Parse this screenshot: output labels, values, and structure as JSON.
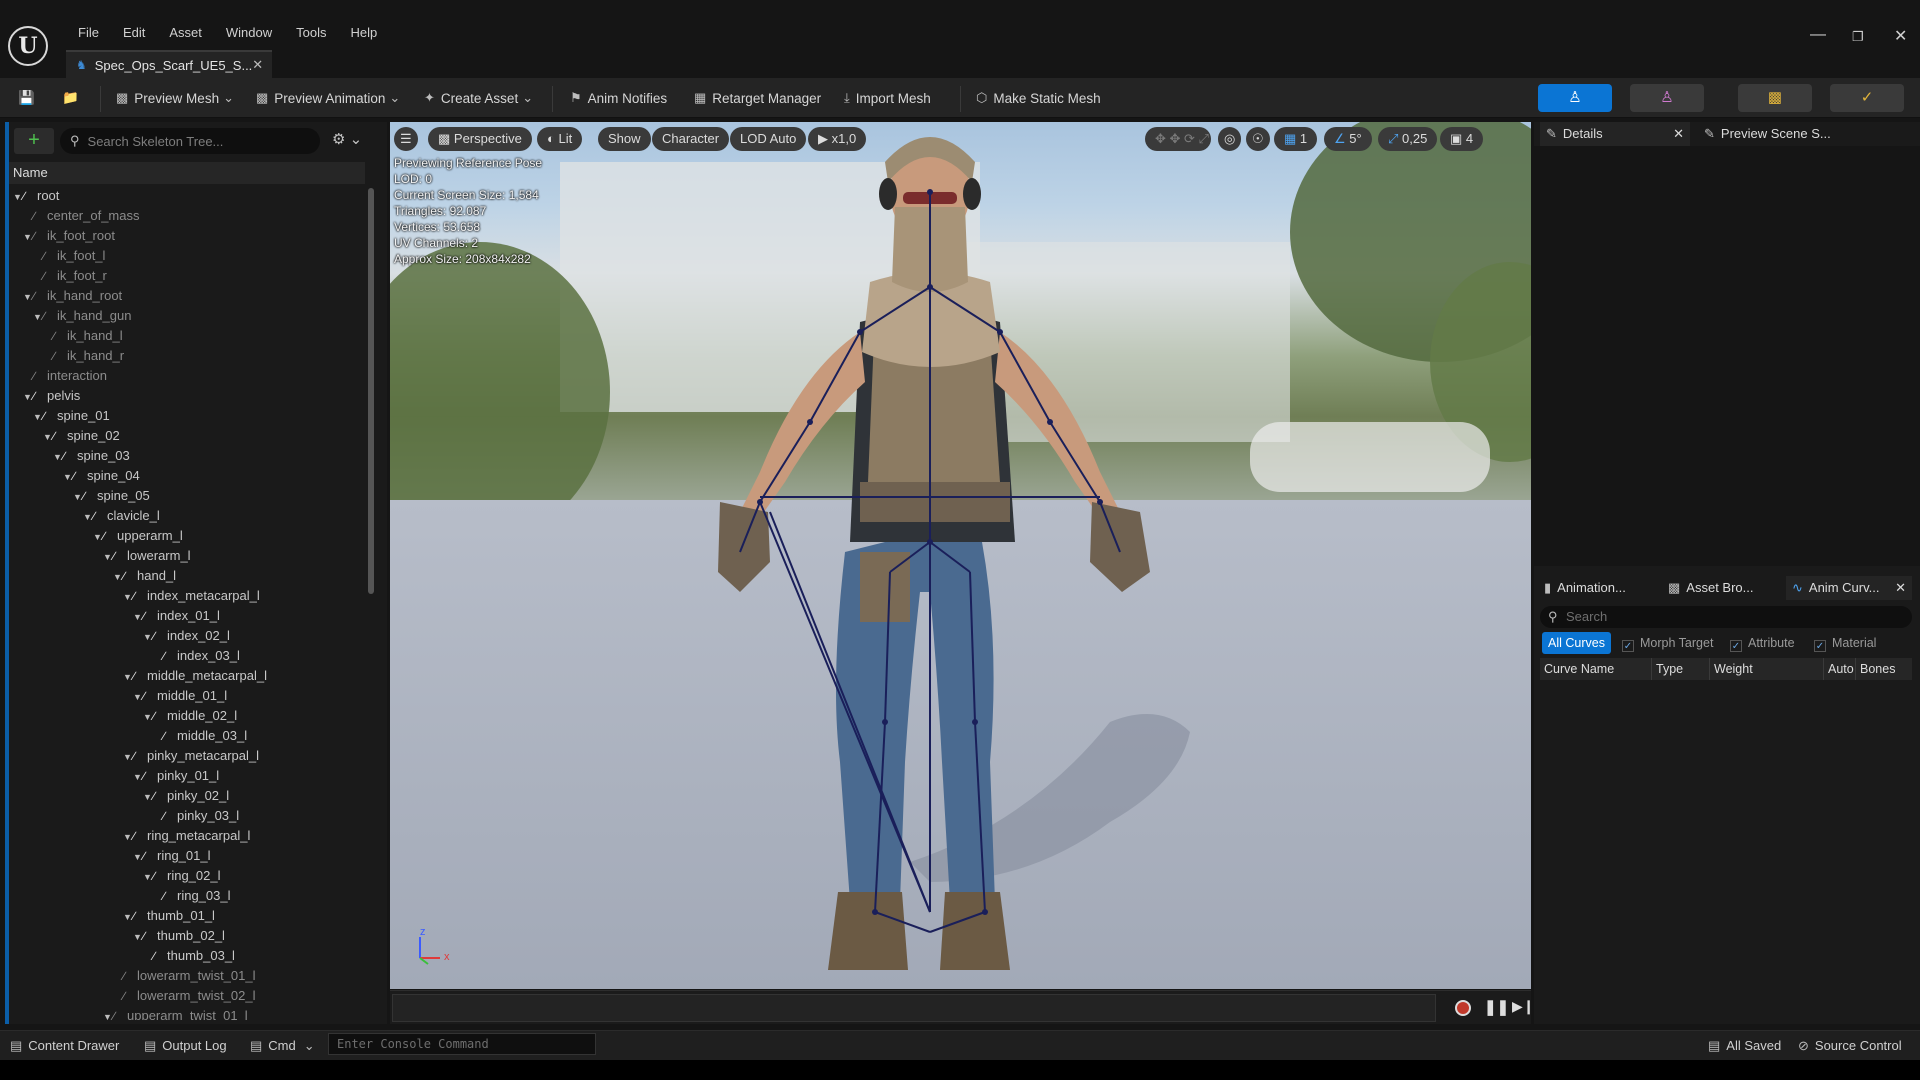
{
  "window": {
    "menu": [
      "File",
      "Edit",
      "Asset",
      "Window",
      "Tools",
      "Help"
    ],
    "tab_title": "Spec_Ops_Scarf_UE5_S...",
    "logo": "U"
  },
  "toolbar": {
    "preview_mesh": "Preview Mesh",
    "preview_animation": "Preview Animation",
    "create_asset": "Create Asset",
    "anim_notifies": "Anim Notifies",
    "retarget_manager": "Retarget Manager",
    "import_mesh": "Import Mesh",
    "make_static_mesh": "Make Static Mesh"
  },
  "skeleton_tree": {
    "search_placeholder": "Search Skeleton Tree...",
    "column_name": "Name",
    "bones": [
      {
        "name": "root",
        "depth": 0,
        "dim": false,
        "expanded": true
      },
      {
        "name": "center_of_mass",
        "depth": 1,
        "dim": true,
        "expanded": null
      },
      {
        "name": "ik_foot_root",
        "depth": 1,
        "dim": true,
        "expanded": true
      },
      {
        "name": "ik_foot_l",
        "depth": 2,
        "dim": true,
        "expanded": null
      },
      {
        "name": "ik_foot_r",
        "depth": 2,
        "dim": true,
        "expanded": null
      },
      {
        "name": "ik_hand_root",
        "depth": 1,
        "dim": true,
        "expanded": true
      },
      {
        "name": "ik_hand_gun",
        "depth": 2,
        "dim": true,
        "expanded": true
      },
      {
        "name": "ik_hand_l",
        "depth": 3,
        "dim": true,
        "expanded": null
      },
      {
        "name": "ik_hand_r",
        "depth": 3,
        "dim": true,
        "expanded": null
      },
      {
        "name": "interaction",
        "depth": 1,
        "dim": true,
        "expanded": null
      },
      {
        "name": "pelvis",
        "depth": 1,
        "dim": false,
        "expanded": true
      },
      {
        "name": "spine_01",
        "depth": 2,
        "dim": false,
        "expanded": true
      },
      {
        "name": "spine_02",
        "depth": 3,
        "dim": false,
        "expanded": true
      },
      {
        "name": "spine_03",
        "depth": 4,
        "dim": false,
        "expanded": true
      },
      {
        "name": "spine_04",
        "depth": 5,
        "dim": false,
        "expanded": true
      },
      {
        "name": "spine_05",
        "depth": 6,
        "dim": false,
        "expanded": true
      },
      {
        "name": "clavicle_l",
        "depth": 7,
        "dim": false,
        "expanded": true
      },
      {
        "name": "upperarm_l",
        "depth": 8,
        "dim": false,
        "expanded": true
      },
      {
        "name": "lowerarm_l",
        "depth": 9,
        "dim": false,
        "expanded": true
      },
      {
        "name": "hand_l",
        "depth": 10,
        "dim": false,
        "expanded": true
      },
      {
        "name": "index_metacarpal_l",
        "depth": 11,
        "dim": false,
        "expanded": true
      },
      {
        "name": "index_01_l",
        "depth": 12,
        "dim": false,
        "expanded": true
      },
      {
        "name": "index_02_l",
        "depth": 13,
        "dim": false,
        "expanded": true
      },
      {
        "name": "index_03_l",
        "depth": 14,
        "dim": false,
        "expanded": null
      },
      {
        "name": "middle_metacarpal_l",
        "depth": 11,
        "dim": false,
        "expanded": true
      },
      {
        "name": "middle_01_l",
        "depth": 12,
        "dim": false,
        "expanded": true
      },
      {
        "name": "middle_02_l",
        "depth": 13,
        "dim": false,
        "expanded": true
      },
      {
        "name": "middle_03_l",
        "depth": 14,
        "dim": false,
        "expanded": null
      },
      {
        "name": "pinky_metacarpal_l",
        "depth": 11,
        "dim": false,
        "expanded": true
      },
      {
        "name": "pinky_01_l",
        "depth": 12,
        "dim": false,
        "expanded": true
      },
      {
        "name": "pinky_02_l",
        "depth": 13,
        "dim": false,
        "expanded": true
      },
      {
        "name": "pinky_03_l",
        "depth": 14,
        "dim": false,
        "expanded": null
      },
      {
        "name": "ring_metacarpal_l",
        "depth": 11,
        "dim": false,
        "expanded": true
      },
      {
        "name": "ring_01_l",
        "depth": 12,
        "dim": false,
        "expanded": true
      },
      {
        "name": "ring_02_l",
        "depth": 13,
        "dim": false,
        "expanded": true
      },
      {
        "name": "ring_03_l",
        "depth": 14,
        "dim": false,
        "expanded": null
      },
      {
        "name": "thumb_01_l",
        "depth": 11,
        "dim": false,
        "expanded": true
      },
      {
        "name": "thumb_02_l",
        "depth": 12,
        "dim": false,
        "expanded": true
      },
      {
        "name": "thumb_03_l",
        "depth": 13,
        "dim": false,
        "expanded": null
      },
      {
        "name": "lowerarm_twist_01_l",
        "depth": 10,
        "dim": true,
        "expanded": null
      },
      {
        "name": "lowerarm_twist_02_l",
        "depth": 10,
        "dim": true,
        "expanded": null
      },
      {
        "name": "upperarm_twist_01_l",
        "depth": 9,
        "dim": true,
        "expanded": true
      }
    ]
  },
  "viewport": {
    "perspective": "Perspective",
    "lit": "Lit",
    "show": "Show",
    "character": "Character",
    "lod": "LOD Auto",
    "speed": "x1,0",
    "grid_value": "1",
    "angle_value": "5°",
    "scale_value": "0,25",
    "camera_speed": "4",
    "axis_z": "z",
    "axis_x": "x",
    "info": [
      "Previewing Reference Pose",
      "LOD: 0",
      "Current Screen Size: 1,584",
      "Triangles: 92.087",
      "Vertices: 53.658",
      "UV Channels: 2",
      "Approx Size: 208x84x282"
    ]
  },
  "details": {
    "tab_details": "Details",
    "tab_preview_scene": "Preview Scene S..."
  },
  "curves_panel": {
    "tab_animation": "Animation...",
    "tab_asset_browser": "Asset Bro...",
    "tab_anim_curves": "Anim Curv...",
    "search_placeholder": "Search",
    "filters": [
      "All Curves",
      "Morph Target",
      "Attribute",
      "Material"
    ],
    "columns": [
      "Curve Name",
      "Type",
      "Weight",
      "Auto",
      "Bones"
    ]
  },
  "statusbar": {
    "content_drawer": "Content Drawer",
    "output_log": "Output Log",
    "cmd": "Cmd",
    "console_placeholder": "Enter Console Command",
    "all_saved": "All Saved",
    "source_control": "Source Control"
  },
  "colors": {
    "accent": "#0b75d4",
    "skeleton": "#1a1f5a",
    "record": "#c0392b"
  }
}
